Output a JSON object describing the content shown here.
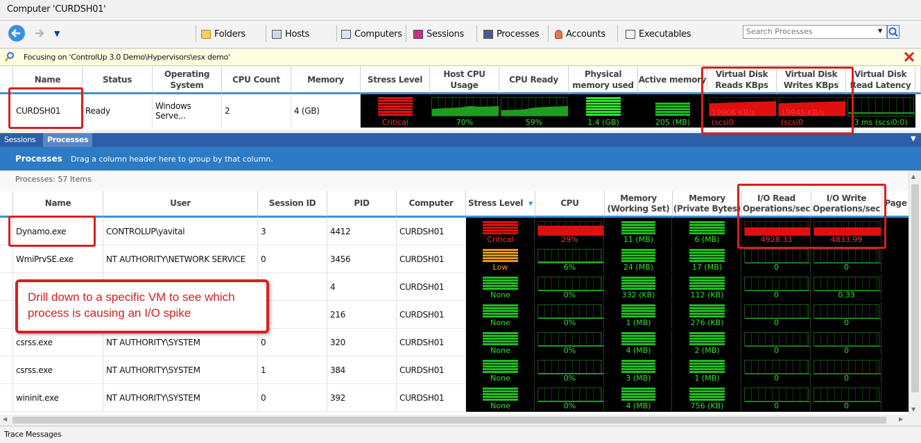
{
  "window": {
    "title": "Computer 'CURDSH01'"
  },
  "toolbar": {
    "items": [
      "Folders",
      "Hosts",
      "Computers",
      "Sessions",
      "Processes",
      "Accounts",
      "Executables"
    ],
    "search_placeholder": "Search Processes"
  },
  "focus": {
    "text": "Focusing on 'ControlUp 3.0 Demo\\Hypervisors\\esx demo'"
  },
  "computer_grid": {
    "headers": [
      "Name",
      "Status",
      "Operating System",
      "CPU Count",
      "Memory",
      "Stress Level",
      "Host CPU Usage",
      "CPU Ready",
      "Physical memory used",
      "Active memory",
      "Virtual Disk Reads KBps",
      "Virtual Disk Writes KBps",
      "Virtual Disk Read Latency"
    ],
    "row": {
      "name": "CURDSH01",
      "status": "Ready",
      "os": "Windows  Serve...",
      "cpu_count": "2",
      "memory": "4 (GB)",
      "stress": "Critical",
      "host_cpu": "70%",
      "cpu_ready": "59%",
      "phys_mem": "1.4 (GB)",
      "active_mem": "205 (MB)",
      "vd_reads": "19906 KB/s (scsi0",
      "vd_writes": "19945 KB/s (scsi0",
      "vd_latency": "3 ms (scsi0:0)"
    }
  },
  "tabs": [
    "Sessions",
    "Processes"
  ],
  "processes_panel": {
    "title": "Processes",
    "hint": "Drag a column header here to group by that column.",
    "count": "Processes: 57 Items"
  },
  "process_grid": {
    "headers": [
      "Name",
      "User",
      "Session ID",
      "PID",
      "Computer",
      "Stress Level",
      "CPU",
      "Memory (Working Set)",
      "Memory (Private Bytes)",
      "I/O Read Operations/sec",
      "I/O Write Operations/sec",
      "Page"
    ],
    "rows": [
      {
        "name": "Dynamo.exe",
        "user": "CONTROLUP\\yavital",
        "session": "3",
        "pid": "4412",
        "computer": "CURDSH01",
        "stress": "Critical",
        "cpu": "29%",
        "ws": "11 (MB)",
        "pb": "6 (MB)",
        "ior": "4928.33",
        "iow": "4833.99"
      },
      {
        "name": "WmiPrvSE.exe",
        "user": "NT AUTHORITY\\NETWORK SERVICE",
        "session": "0",
        "pid": "3456",
        "computer": "CURDSH01",
        "stress": "Low",
        "cpu": "6%",
        "ws": "24 (MB)",
        "pb": "17 (MB)",
        "ior": "0",
        "iow": "0"
      },
      {
        "name": "",
        "user": "",
        "session": "",
        "pid": "4",
        "computer": "CURDSH01",
        "stress": "None",
        "cpu": "0%",
        "ws": "332 (KB)",
        "pb": "112 (KB)",
        "ior": "0",
        "iow": "0.33"
      },
      {
        "name": "",
        "user": "",
        "session": "",
        "pid": "216",
        "computer": "CURDSH01",
        "stress": "None",
        "cpu": "0%",
        "ws": "1 (MB)",
        "pb": "276 (KB)",
        "ior": "0",
        "iow": "0"
      },
      {
        "name": "csrss.exe",
        "user": "NT AUTHORITY\\SYSTEM",
        "session": "0",
        "pid": "320",
        "computer": "CURDSH01",
        "stress": "None",
        "cpu": "0%",
        "ws": "4 (MB)",
        "pb": "2 (MB)",
        "ior": "0",
        "iow": "0"
      },
      {
        "name": "csrss.exe",
        "user": "NT AUTHORITY\\SYSTEM",
        "session": "1",
        "pid": "384",
        "computer": "CURDSH01",
        "stress": "None",
        "cpu": "0%",
        "ws": "3 (MB)",
        "pb": "1 (MB)",
        "ior": "0",
        "iow": "0"
      },
      {
        "name": "wininit.exe",
        "user": "NT AUTHORITY\\SYSTEM",
        "session": "0",
        "pid": "392",
        "computer": "CURDSH01",
        "stress": "None",
        "cpu": "0%",
        "ws": "4 (MB)",
        "pb": "756 (KB)",
        "ior": "0",
        "iow": "0"
      }
    ]
  },
  "callout": {
    "text": "Drill down to a specific VM to see which process is causing an I/O spike"
  },
  "statusbar": {
    "text": "Trace Messages"
  },
  "colors": {
    "critical": "#e01010",
    "low": "#e89a20",
    "none": "#1fbf1f",
    "accent": "#2b7bc7",
    "annotation": "#d62020"
  }
}
